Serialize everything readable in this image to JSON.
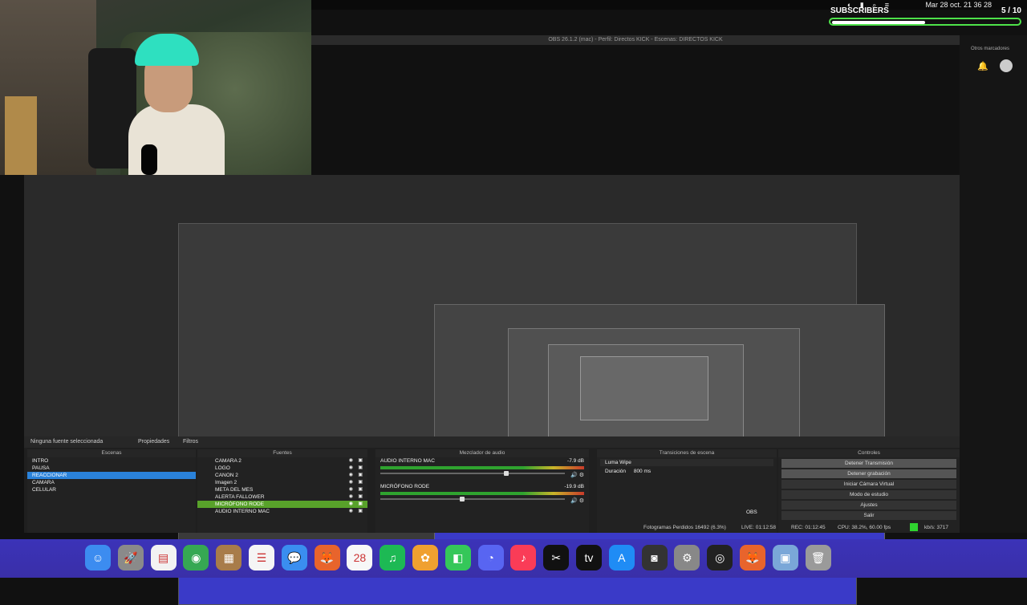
{
  "menubar": {
    "clock": "Mar 28 oct. 21 36 28",
    "icons": [
      "wifi-icon",
      "battery-icon",
      "search-icon",
      "control-center-icon"
    ]
  },
  "subscribers": {
    "label": "SUBSCRIBERS",
    "count": "5 / 10",
    "progress": 0.5,
    "accent": "#4ee34a"
  },
  "window": {
    "title": "OBS 26.1.2 (mac) - Perfil: Directos KICK - Escenas: DIRECTOS KICK",
    "bookmarks": "Otros marcadores"
  },
  "toolbar": {
    "no_source": "Ninguna fuente seleccionada",
    "properties": "Propiedades",
    "filters": "Filtros"
  },
  "scenes": {
    "header": "Escenas",
    "items": [
      "INTRO",
      "PAUSA",
      "REACCIONAR",
      "CAMARA",
      "CELULAR"
    ],
    "selected": 2
  },
  "sources": {
    "header": "Fuentes",
    "items": [
      "CAMARA 2",
      "LOGO",
      "CANON 2",
      "Imagen 2",
      "META DEL MES",
      "ALERTA FALLOWER",
      "MICRÓFONO RODE",
      "AUDIO INTERNO MAC"
    ],
    "selected": 6
  },
  "mixer": {
    "header": "Mezclador de audio",
    "channels": [
      {
        "name": "AUDIO INTERNO MAC",
        "db": "-7.9 dB",
        "level": 0.7
      },
      {
        "name": "MICRÓFONO RODE",
        "db": "-19.9 dB",
        "level": 0.45
      }
    ]
  },
  "transitions": {
    "header": "Transiciones de escena",
    "selected": "Luma Wipe",
    "duration_label": "Duración",
    "duration_value": "800 ms"
  },
  "controls": {
    "header": "Controles",
    "buttons": [
      "Detener Transmisión",
      "Detener grabación",
      "Iniciar Cámara Virtual",
      "Modo de estudio",
      "Ajustes",
      "Salir"
    ],
    "obs_label": "OBS"
  },
  "status": {
    "dropped": "Fotogramas Perdidos 16492 (6.3%)",
    "live": "LIVE: 01:12:58",
    "rec": "REC: 01:12:45",
    "cpu": "CPU: 38.2%, 60.00 fps",
    "kbps": "kb/s: 3717",
    "accent": "#2fd32f"
  },
  "dock": {
    "icons": [
      {
        "name": "finder-icon",
        "glyph": "☺",
        "color": "#3c8cf0"
      },
      {
        "name": "launchpad-icon",
        "glyph": "🚀",
        "color": "#8a8a8a"
      },
      {
        "name": "notes-icon",
        "glyph": "▤",
        "color": "#f2f2f2"
      },
      {
        "name": "chrome-icon",
        "glyph": "◉",
        "color": "#36a853"
      },
      {
        "name": "archive-icon",
        "glyph": "▦",
        "color": "#a87c4a"
      },
      {
        "name": "reminders-icon",
        "glyph": "☰",
        "color": "#f5f5f5"
      },
      {
        "name": "messages-icon",
        "glyph": "💬",
        "color": "#3a8ef0"
      },
      {
        "name": "firefox-icon",
        "glyph": "🦊",
        "color": "#e8642c"
      },
      {
        "name": "calendar-icon",
        "glyph": "28",
        "color": "#f7f7f7"
      },
      {
        "name": "spotify-icon",
        "glyph": "♫",
        "color": "#1db954"
      },
      {
        "name": "photos-icon",
        "glyph": "✿",
        "color": "#f0a030"
      },
      {
        "name": "facetime-icon",
        "glyph": "◧",
        "color": "#35c759"
      },
      {
        "name": "discord-icon",
        "glyph": "◔",
        "color": "#5865f2"
      },
      {
        "name": "music-icon",
        "glyph": "♪",
        "color": "#fa3c57"
      },
      {
        "name": "capcut-icon",
        "glyph": "✂",
        "color": "#111111"
      },
      {
        "name": "appletv-icon",
        "glyph": "tv",
        "color": "#111111"
      },
      {
        "name": "appstore-icon",
        "glyph": "A",
        "color": "#1f8cf5"
      },
      {
        "name": "photo-booth-icon",
        "glyph": "◙",
        "color": "#333333"
      },
      {
        "name": "system-preferences-icon",
        "glyph": "⚙",
        "color": "#888888"
      },
      {
        "name": "obs-icon",
        "glyph": "◎",
        "color": "#222222"
      },
      {
        "name": "firefox-2-icon",
        "glyph": "🦊",
        "color": "#e8642c"
      },
      {
        "name": "preview-icon",
        "glyph": "▣",
        "color": "#7aa7d8"
      },
      {
        "name": "trash-icon",
        "glyph": "🗑",
        "color": "#9a9a9a"
      }
    ]
  }
}
